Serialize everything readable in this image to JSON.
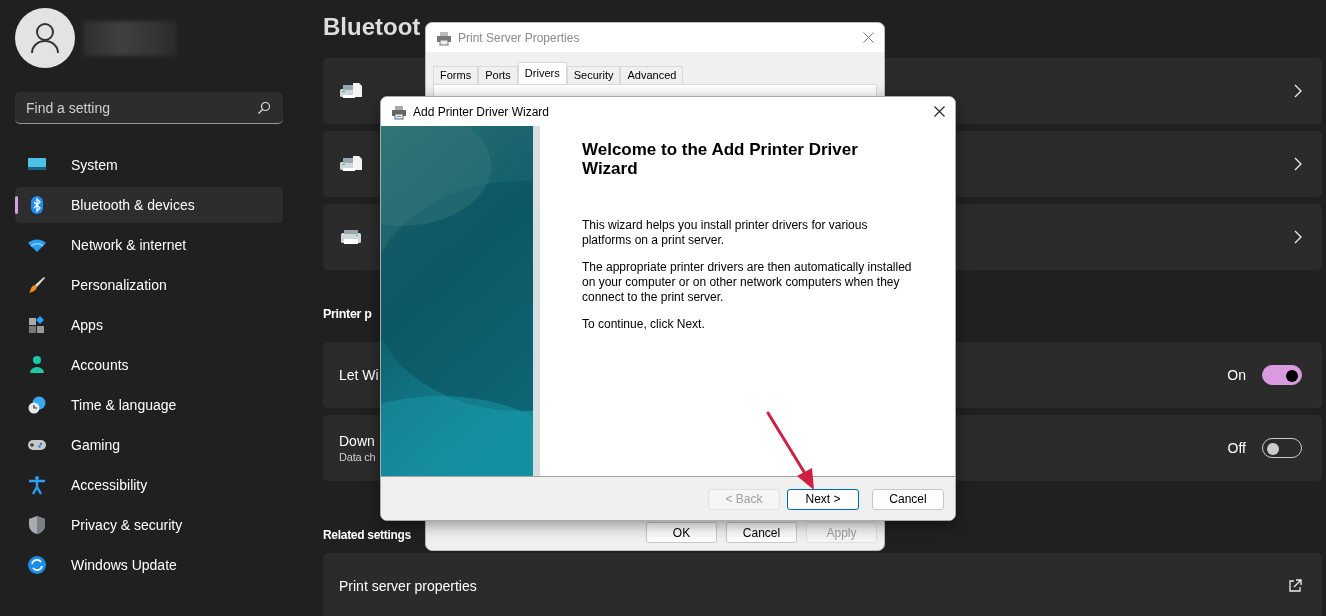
{
  "sidebar": {
    "search": {
      "placeholder": "Find a setting"
    },
    "items": [
      {
        "label": "System",
        "selected": false
      },
      {
        "label": "Bluetooth & devices",
        "selected": true
      },
      {
        "label": "Network & internet",
        "selected": false
      },
      {
        "label": "Personalization",
        "selected": false
      },
      {
        "label": "Apps",
        "selected": false
      },
      {
        "label": "Accounts",
        "selected": false
      },
      {
        "label": "Time & language",
        "selected": false
      },
      {
        "label": "Gaming",
        "selected": false
      },
      {
        "label": "Accessibility",
        "selected": false
      },
      {
        "label": "Privacy & security",
        "selected": false
      },
      {
        "label": "Windows Update",
        "selected": false
      }
    ]
  },
  "page": {
    "title": "Bluetoot",
    "printers": [
      {
        "kind": "document"
      },
      {
        "kind": "document"
      },
      {
        "kind": "plain"
      }
    ],
    "preferences_heading": "Printer p",
    "toggles": [
      {
        "label": "Let Wi",
        "state": "On",
        "on": true
      },
      {
        "label": "Down",
        "description": "Data ch",
        "state": "Off",
        "on": false
      }
    ],
    "related_heading": "Related settings",
    "related": [
      {
        "label": "Print server properties"
      }
    ]
  },
  "print_server_dialog": {
    "title": "Print Server Properties",
    "tabs": [
      {
        "label": "Forms",
        "selected": false
      },
      {
        "label": "Ports",
        "selected": false
      },
      {
        "label": "Drivers",
        "selected": true
      },
      {
        "label": "Security",
        "selected": false
      },
      {
        "label": "Advanced",
        "selected": false
      }
    ],
    "buttons": [
      {
        "label": "OK",
        "disabled": false
      },
      {
        "label": "Cancel",
        "disabled": false
      },
      {
        "label": "Apply",
        "disabled": true
      }
    ]
  },
  "wizard": {
    "title": "Add Printer Driver Wizard",
    "heading": "Welcome to the Add Printer Driver Wizard",
    "paragraphs": [
      "This wizard helps you install printer drivers for various platforms on a print server.",
      "The appropriate printer drivers are then automatically installed on your computer or on other network computers when they connect to the print server.",
      "To continue, click Next."
    ],
    "buttons": [
      {
        "label": "< Back",
        "disabled": true,
        "default": false
      },
      {
        "label": "Next >",
        "disabled": false,
        "default": true
      },
      {
        "label": "Cancel",
        "disabled": false,
        "default": false
      }
    ]
  }
}
